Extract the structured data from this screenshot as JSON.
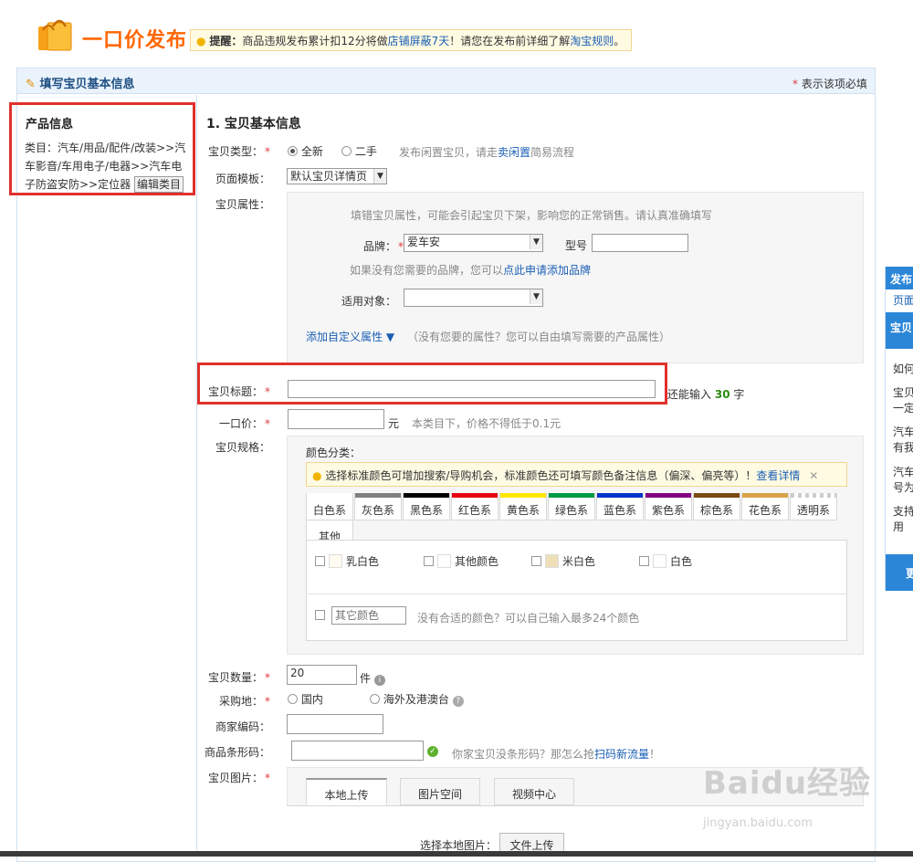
{
  "header": {
    "title": "一口价发布",
    "tip_label": "提醒：",
    "tip_text_1": "商品违规发布累计扣12分将做",
    "tip_link_1": "店铺屏蔽7天",
    "tip_text_2": "！请您在发布前详细了解",
    "tip_link_2": "淘宝规则",
    "tip_text_3": "。"
  },
  "panel": {
    "title": "填写宝贝基本信息",
    "required_note": "表示该项必填"
  },
  "sidebar": {
    "title": "产品信息",
    "category": "类目：汽车/用品/配件/改装>>汽车影音/车用电子/电器>>汽车电子防盗安防>>定位器",
    "edit_button": "编辑类目"
  },
  "form": {
    "section_title": "1. 宝贝基本信息",
    "type": {
      "label": "宝贝类型：",
      "opt_new": "全新",
      "opt_used": "二手",
      "hint": "发布闲置宝贝，请走",
      "hint_link": "卖闲置",
      "hint_tail": "简易流程"
    },
    "template": {
      "label": "页面模板：",
      "value": "默认宝贝详情页"
    },
    "attributes": {
      "label": "宝贝属性：",
      "warning": "填错宝贝属性，可能会引起宝贝下架，影响您的正常销售。请认真准确填写",
      "brand_label": "品牌：",
      "brand_value": "爱车安",
      "model_label": "型号",
      "brand_hint": "如果没有您需要的品牌，您可以",
      "brand_hint_link": "点此申请添加品牌",
      "target_label": "适用对象：",
      "add_custom": "添加自定义属性",
      "add_custom_hint": "（没有您要的属性？您可以自由填写需要的产品属性）"
    },
    "title_field": {
      "label": "宝贝标题：",
      "remaining_prefix": "还能输入",
      "remaining": "30",
      "remaining_suffix": "字"
    },
    "price": {
      "label": "一口价：",
      "unit": "元",
      "hint": "本类目下，价格不得低于0.1元"
    },
    "spec": {
      "label": "宝贝规格：",
      "color_label": "颜色分类：",
      "notice": "选择标准颜色可增加搜索/导购机会，标准颜色还可填写颜色备注信息（偏深、偏亮等）！",
      "notice_link": "查看详情",
      "tabs": [
        {
          "label": "白色系",
          "color": "#ffffff"
        },
        {
          "label": "灰色系",
          "color": "#808080"
        },
        {
          "label": "黑色系",
          "color": "#000000"
        },
        {
          "label": "红色系",
          "color": "#e60012"
        },
        {
          "label": "黄色系",
          "color": "#ffe600"
        },
        {
          "label": "绿色系",
          "color": "#009944"
        },
        {
          "label": "蓝色系",
          "color": "#0033cc"
        },
        {
          "label": "紫色系",
          "color": "#800080"
        },
        {
          "label": "棕色系",
          "color": "#7b4a12"
        },
        {
          "label": "花色系",
          "color": "#d9a34a"
        },
        {
          "label": "透明系",
          "color": "#e0e0e0"
        },
        {
          "label": "其他",
          "color": "#ffffff"
        }
      ],
      "colors": [
        {
          "label": "乳白色",
          "swatch": "#fffbf0"
        },
        {
          "label": "其他颜色",
          "swatch": "#ffffff"
        },
        {
          "label": "米白色",
          "swatch": "#eedfb8"
        },
        {
          "label": "白色",
          "swatch": "#ffffff"
        }
      ],
      "other_placeholder": "其它颜色",
      "other_hint": "没有合适的颜色？可以自己输入最多24个颜色"
    },
    "quantity": {
      "label": "宝贝数量：",
      "value": "20",
      "unit": "件"
    },
    "origin": {
      "label": "采购地：",
      "opt_domestic": "国内",
      "opt_abroad": "海外及港澳台"
    },
    "merchant_code": {
      "label": "商家编码："
    },
    "barcode": {
      "label": "商品条形码：",
      "hint": "你家宝贝没条形码？那怎么抢",
      "hint_link": "扫码新流量",
      "hint_tail": "！"
    },
    "images": {
      "label": "宝贝图片：",
      "tabs": [
        "本地上传",
        "图片空间",
        "视频中心"
      ],
      "choose_label": "选择本地图片：",
      "upload_button": "文件上传"
    }
  },
  "right_panel": {
    "publish": "发布",
    "page": "页面",
    "item": "宝贝",
    "q1": "如何",
    "q2a": "宝贝",
    "q2b": "一定",
    "q3a": "汽车",
    "q3b": "有我",
    "q4a": "汽车",
    "q4b": "号为",
    "q5a": "支持",
    "q5b": "用",
    "more": "更"
  },
  "watermark": {
    "brand": "Baidu经验",
    "url": "jingyan.baidu.com"
  }
}
